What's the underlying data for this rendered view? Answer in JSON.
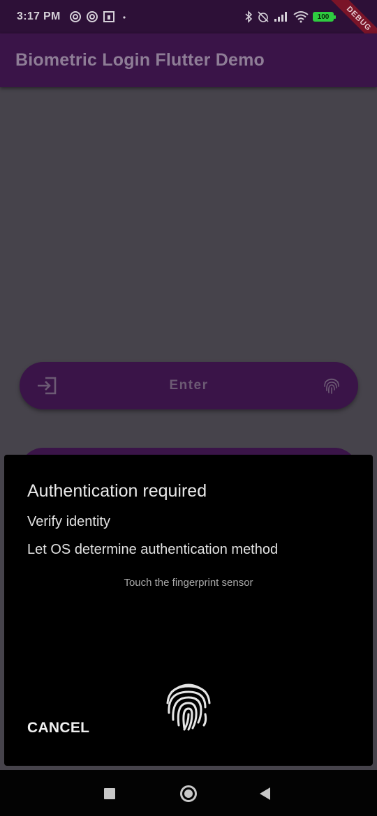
{
  "status_bar": {
    "time": "3:17 PM",
    "battery": "100",
    "left_icons": [
      "at-sign-icon",
      "at-sign-icon",
      "calendar-icon",
      "dot-icon"
    ],
    "right_icons": [
      "bluetooth-icon",
      "alarm-off-icon",
      "signal-icon",
      "wifi-icon",
      "battery-icon"
    ]
  },
  "debug_banner": "DEBUG",
  "app_bar": {
    "title": "Biometric Login Flutter Demo"
  },
  "enter_button": {
    "label": "Enter",
    "leading_icon": "login-icon",
    "trailing_icon": "fingerprint-icon"
  },
  "auth_dialog": {
    "title": "Authentication required",
    "subtitle": "Verify identity",
    "description": "Let OS determine authentication method",
    "hint": "Touch the fingerprint sensor",
    "icon": "fingerprint-icon",
    "cancel_label": "CANCEL"
  },
  "nav_bar": {
    "items": [
      "recents-icon",
      "home-icon",
      "back-icon"
    ]
  },
  "colors": {
    "scrim": "#46434b",
    "app_bar": "#3a1448",
    "status_bar": "#2d1037",
    "dialog": "#000000",
    "battery": "#2ecc40"
  }
}
